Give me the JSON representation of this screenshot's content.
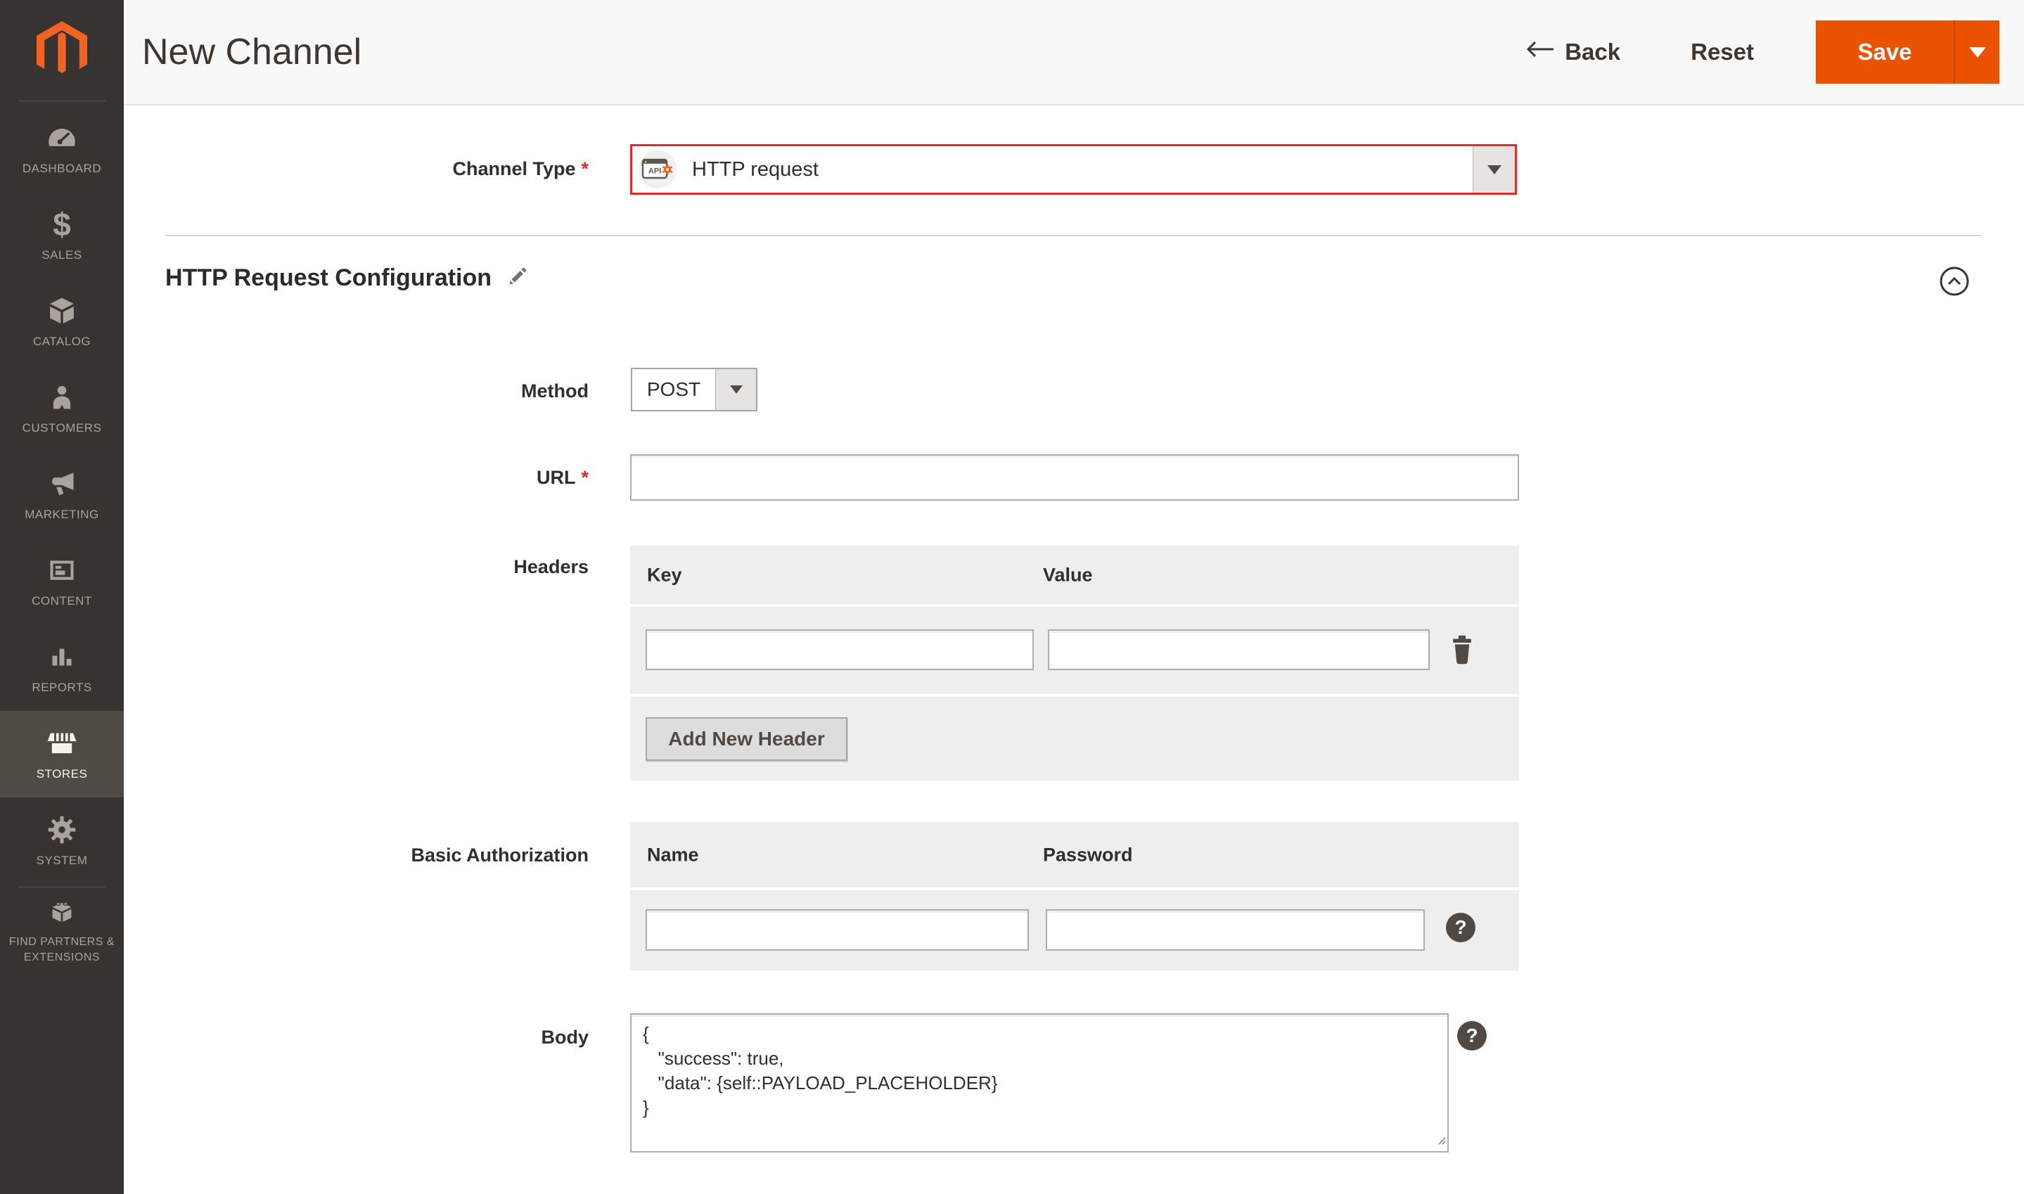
{
  "sidebar": {
    "items": [
      {
        "label": "DASHBOARD"
      },
      {
        "label": "SALES"
      },
      {
        "label": "CATALOG"
      },
      {
        "label": "CUSTOMERS"
      },
      {
        "label": "MARKETING"
      },
      {
        "label": "CONTENT"
      },
      {
        "label": "REPORTS"
      },
      {
        "label": "STORES",
        "active": true
      },
      {
        "label": "SYSTEM"
      },
      {
        "label": "FIND PARTNERS & EXTENSIONS"
      }
    ]
  },
  "header": {
    "title": "New Channel",
    "back_label": "Back",
    "reset_label": "Reset",
    "save_label": "Save"
  },
  "form": {
    "channel_type": {
      "label": "Channel Type",
      "required_marker": "*",
      "value": "HTTP request"
    },
    "section_title": "HTTP Request Configuration",
    "method": {
      "label": "Method",
      "value": "POST"
    },
    "url": {
      "label": "URL",
      "required_marker": "*",
      "value": ""
    },
    "headers": {
      "label": "Headers",
      "key_header": "Key",
      "value_header": "Value",
      "key_value": "",
      "value_value": "",
      "add_button_label": "Add New Header"
    },
    "basic_authorization": {
      "label": "Basic Authorization",
      "name_header": "Name",
      "password_header": "Password",
      "name_value": "",
      "password_value": ""
    },
    "body": {
      "label": "Body",
      "value": "{\n   \"success\": true,\n   \"data\": {self::PAYLOAD_PLACEHOLDER}\n}",
      "help_marker": "?"
    },
    "auth_help_marker": "?"
  },
  "colors": {
    "accent": "#eb5202",
    "error": "#e02b27",
    "sidebar_bg": "#373330",
    "sidebar_active_bg": "#4f4a44",
    "panel_bg": "#eeeeee",
    "header_bg": "#f8f8f8"
  }
}
